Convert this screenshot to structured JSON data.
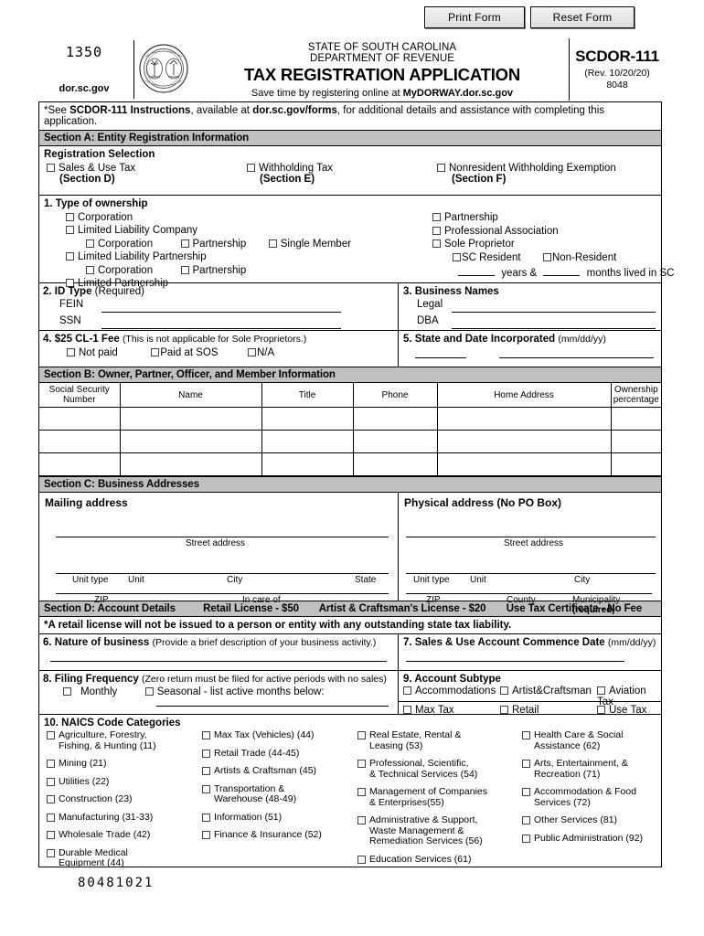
{
  "toolbar": {
    "print_form": "Print Form",
    "reset_form": "Reset Form"
  },
  "masthead": {
    "form_number_left": "1350",
    "website": "dor.sc.gov",
    "seal_alt": "south-carolina-state-seal",
    "line1": "STATE OF SOUTH CAROLINA",
    "line2": "DEPARTMENT OF REVENUE",
    "title": "TAX REGISTRATION APPLICATION",
    "online_prefix": "Save time by registering online at ",
    "online_link": "MyDORWAY.dor.sc.gov",
    "form_code": "SCDOR-111",
    "revision": "(Rev. 10/20/20)",
    "doc_code": "8048"
  },
  "instruction_note": {
    "p1": "*See ",
    "b1": "SCDOR-111 Instructions",
    "p2": ", available at ",
    "b2": "dor.sc.gov/forms",
    "p3": ", for additional details and assistance with completing this application."
  },
  "section_a": {
    "header": "Section A: Entity Registration Information",
    "registration_selection_label": "Registration Selection",
    "registration_options": [
      {
        "label": "Sales & Use Tax",
        "section": "(Section D)"
      },
      {
        "label": "Withholding Tax",
        "section": "(Section E)"
      },
      {
        "label": "Nonresident Withholding Exemption",
        "section": "(Section F)"
      }
    ],
    "q1": {
      "title": "1. Type of ownership",
      "left": [
        "Corporation",
        "Limited Liability Company",
        "Corporation",
        "Partnership",
        "Single Member",
        "Limited Liability Partnership",
        "Corporation",
        "Partnership",
        "Limited Partnership"
      ],
      "right": [
        "Partnership",
        "Professional Association",
        "Sole Proprietor",
        "SC Resident",
        "Non-Resident"
      ],
      "residency_line": {
        "years_label": "years &",
        "months_label": "months lived in SC"
      }
    },
    "q2": {
      "title": "2. ID Type",
      "title_note": "(Required)",
      "fein_label": "FEIN",
      "ssn_label": "SSN",
      "fein_value": "",
      "ssn_value": ""
    },
    "q3": {
      "title": "3. Business Names",
      "legal_label": "Legal",
      "dba_label": "DBA",
      "legal_value": "",
      "dba_value": ""
    },
    "q4": {
      "title": "4. $25 CL-1 Fee",
      "title_note": "(This is not applicable for Sole Proprietors.)",
      "options": [
        "Not paid",
        "Paid at SOS",
        "N/A"
      ]
    },
    "q5": {
      "title": "5. State and Date Incorporated",
      "title_note": "(mm/dd/yy)",
      "state_value": "",
      "date_value": ""
    }
  },
  "section_b": {
    "header": "Section B: Owner, Partner, Officer, and Member Information",
    "columns": [
      "Social Security\nNumber",
      "Name",
      "Title",
      "Phone",
      "Home Address",
      "Ownership\npercentage"
    ],
    "rows": [
      [
        "",
        "",
        "",
        "",
        "",
        ""
      ],
      [
        "",
        "",
        "",
        "",
        "",
        ""
      ],
      [
        "",
        "",
        "",
        "",
        "",
        ""
      ]
    ]
  },
  "section_c": {
    "header": "Section C: Business Addresses",
    "mailing": {
      "title": "Mailing address",
      "captions": [
        "Street address",
        "Unit type",
        "Unit",
        "City",
        "State",
        "ZIP",
        "In care of"
      ]
    },
    "physical": {
      "title": "Physical address (No PO Box)",
      "captions": [
        "Street address",
        "Unit type",
        "Unit",
        "City",
        "ZIP",
        "County"
      ],
      "municipality_prefix": "Municipality ",
      "municipality_required": "(required)"
    }
  },
  "section_d": {
    "header": "Section D: Account Details",
    "header_fees": [
      "Retail License - $50",
      "Artist & Craftsman's License - $20",
      "Use Tax Certificate - No Fee"
    ],
    "warning": "*A retail license will not be issued to a person or entity with any outstanding state tax liability.",
    "q6": {
      "title": "6. Nature of business",
      "title_note": "(Provide a brief description of your business activity.)",
      "value": ""
    },
    "q7": {
      "title": "7. Sales & Use Account Commence Date",
      "title_note": "(mm/dd/yy)",
      "value": ""
    },
    "q8": {
      "title": "8. Filing Frequency",
      "title_note": "(Zero return must be filed for active periods with no sales)",
      "monthly": "Monthly",
      "seasonal": "Seasonal - list active months below:",
      "seasonal_value": ""
    },
    "q9": {
      "title": "9. Account Subtype",
      "options": [
        "Accommodations",
        "Artist&Craftsman",
        "Aviation Tax",
        "Max Tax",
        "Retail",
        "Use Tax"
      ]
    },
    "q10": {
      "title": "10. NAICS Code Categories",
      "col1": [
        "Agriculture, Forestry,\nFishing, & Hunting (11)",
        "Mining (21)",
        "Utilities (22)",
        "Construction (23)",
        "Manufacturing (31-33)",
        "Wholesale Trade (42)",
        "Durable Medical\nEquipment (44)"
      ],
      "col2": [
        "Max Tax (Vehicles) (44)",
        "Retail Trade (44-45)",
        "Artists & Craftsman (45)",
        "Transportation &\nWarehouse (48-49)",
        "Information (51)",
        "Finance & Insurance (52)"
      ],
      "col3": [
        "Real Estate, Rental &\nLeasing (53)",
        "Professional, Scientific,\n& Technical Services (54)",
        "Management of Companies\n& Enterprises(55)",
        "Administrative & Support,\nWaste Management &\nRemediation Services (56)",
        "Education Services (61)"
      ],
      "col4": [
        "Health Care & Social\nAssistance (62)",
        "Arts, Entertainment, &\nRecreation (71)",
        "Accommodation & Food\nServices (72)",
        "Other Services (81)",
        "Public Administration (92)"
      ]
    }
  },
  "footer": {
    "barcode_number": "80481021"
  }
}
